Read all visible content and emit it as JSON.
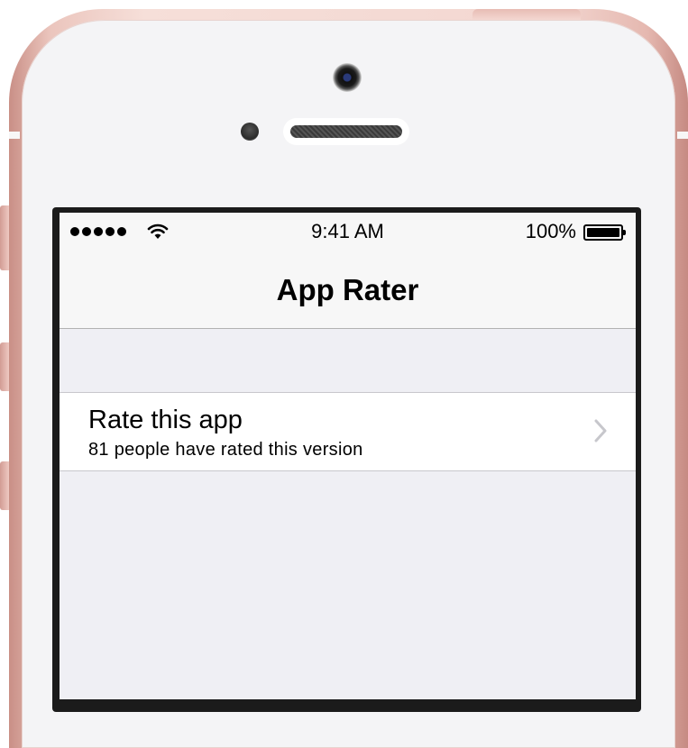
{
  "status_bar": {
    "time": "9:41 AM",
    "battery_percent": "100%",
    "signal_bars": 5,
    "icons": [
      "signal-dots-icon",
      "wifi-icon",
      "battery-icon"
    ]
  },
  "nav_bar": {
    "title": "App Rater"
  },
  "table": {
    "rows": [
      {
        "title": "Rate this app",
        "subtitle": "81 people have rated this version",
        "accessory": "chevron-right-icon"
      }
    ]
  },
  "colors": {
    "device_rose_gold": "#ebc5bd",
    "nav_background": "#f7f7f7",
    "grouped_background": "#efeff4",
    "separator": "#c8c7cc",
    "chevron": "#c7c7cc"
  }
}
